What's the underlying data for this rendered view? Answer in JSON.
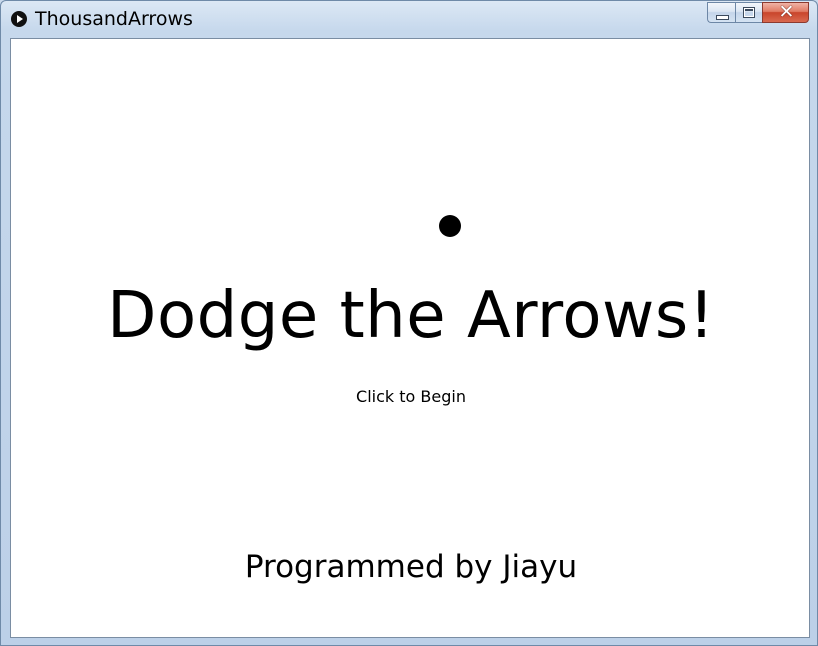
{
  "window": {
    "title": "ThousandArrows",
    "icon": "play-circle-icon",
    "controls": {
      "minimize_icon": "minimize-icon",
      "maximize_icon": "maximize-icon",
      "close_icon": "close-icon",
      "close_glyph": "✕"
    }
  },
  "game": {
    "headline": "Dodge the Arrows!",
    "prompt": "Click to Begin",
    "credits": "Programmed by Jiayu",
    "player_color": "#000000",
    "background_color": "#ffffff"
  },
  "colors": {
    "close_button": "#c9452b",
    "frame": "#bcd0e8"
  }
}
